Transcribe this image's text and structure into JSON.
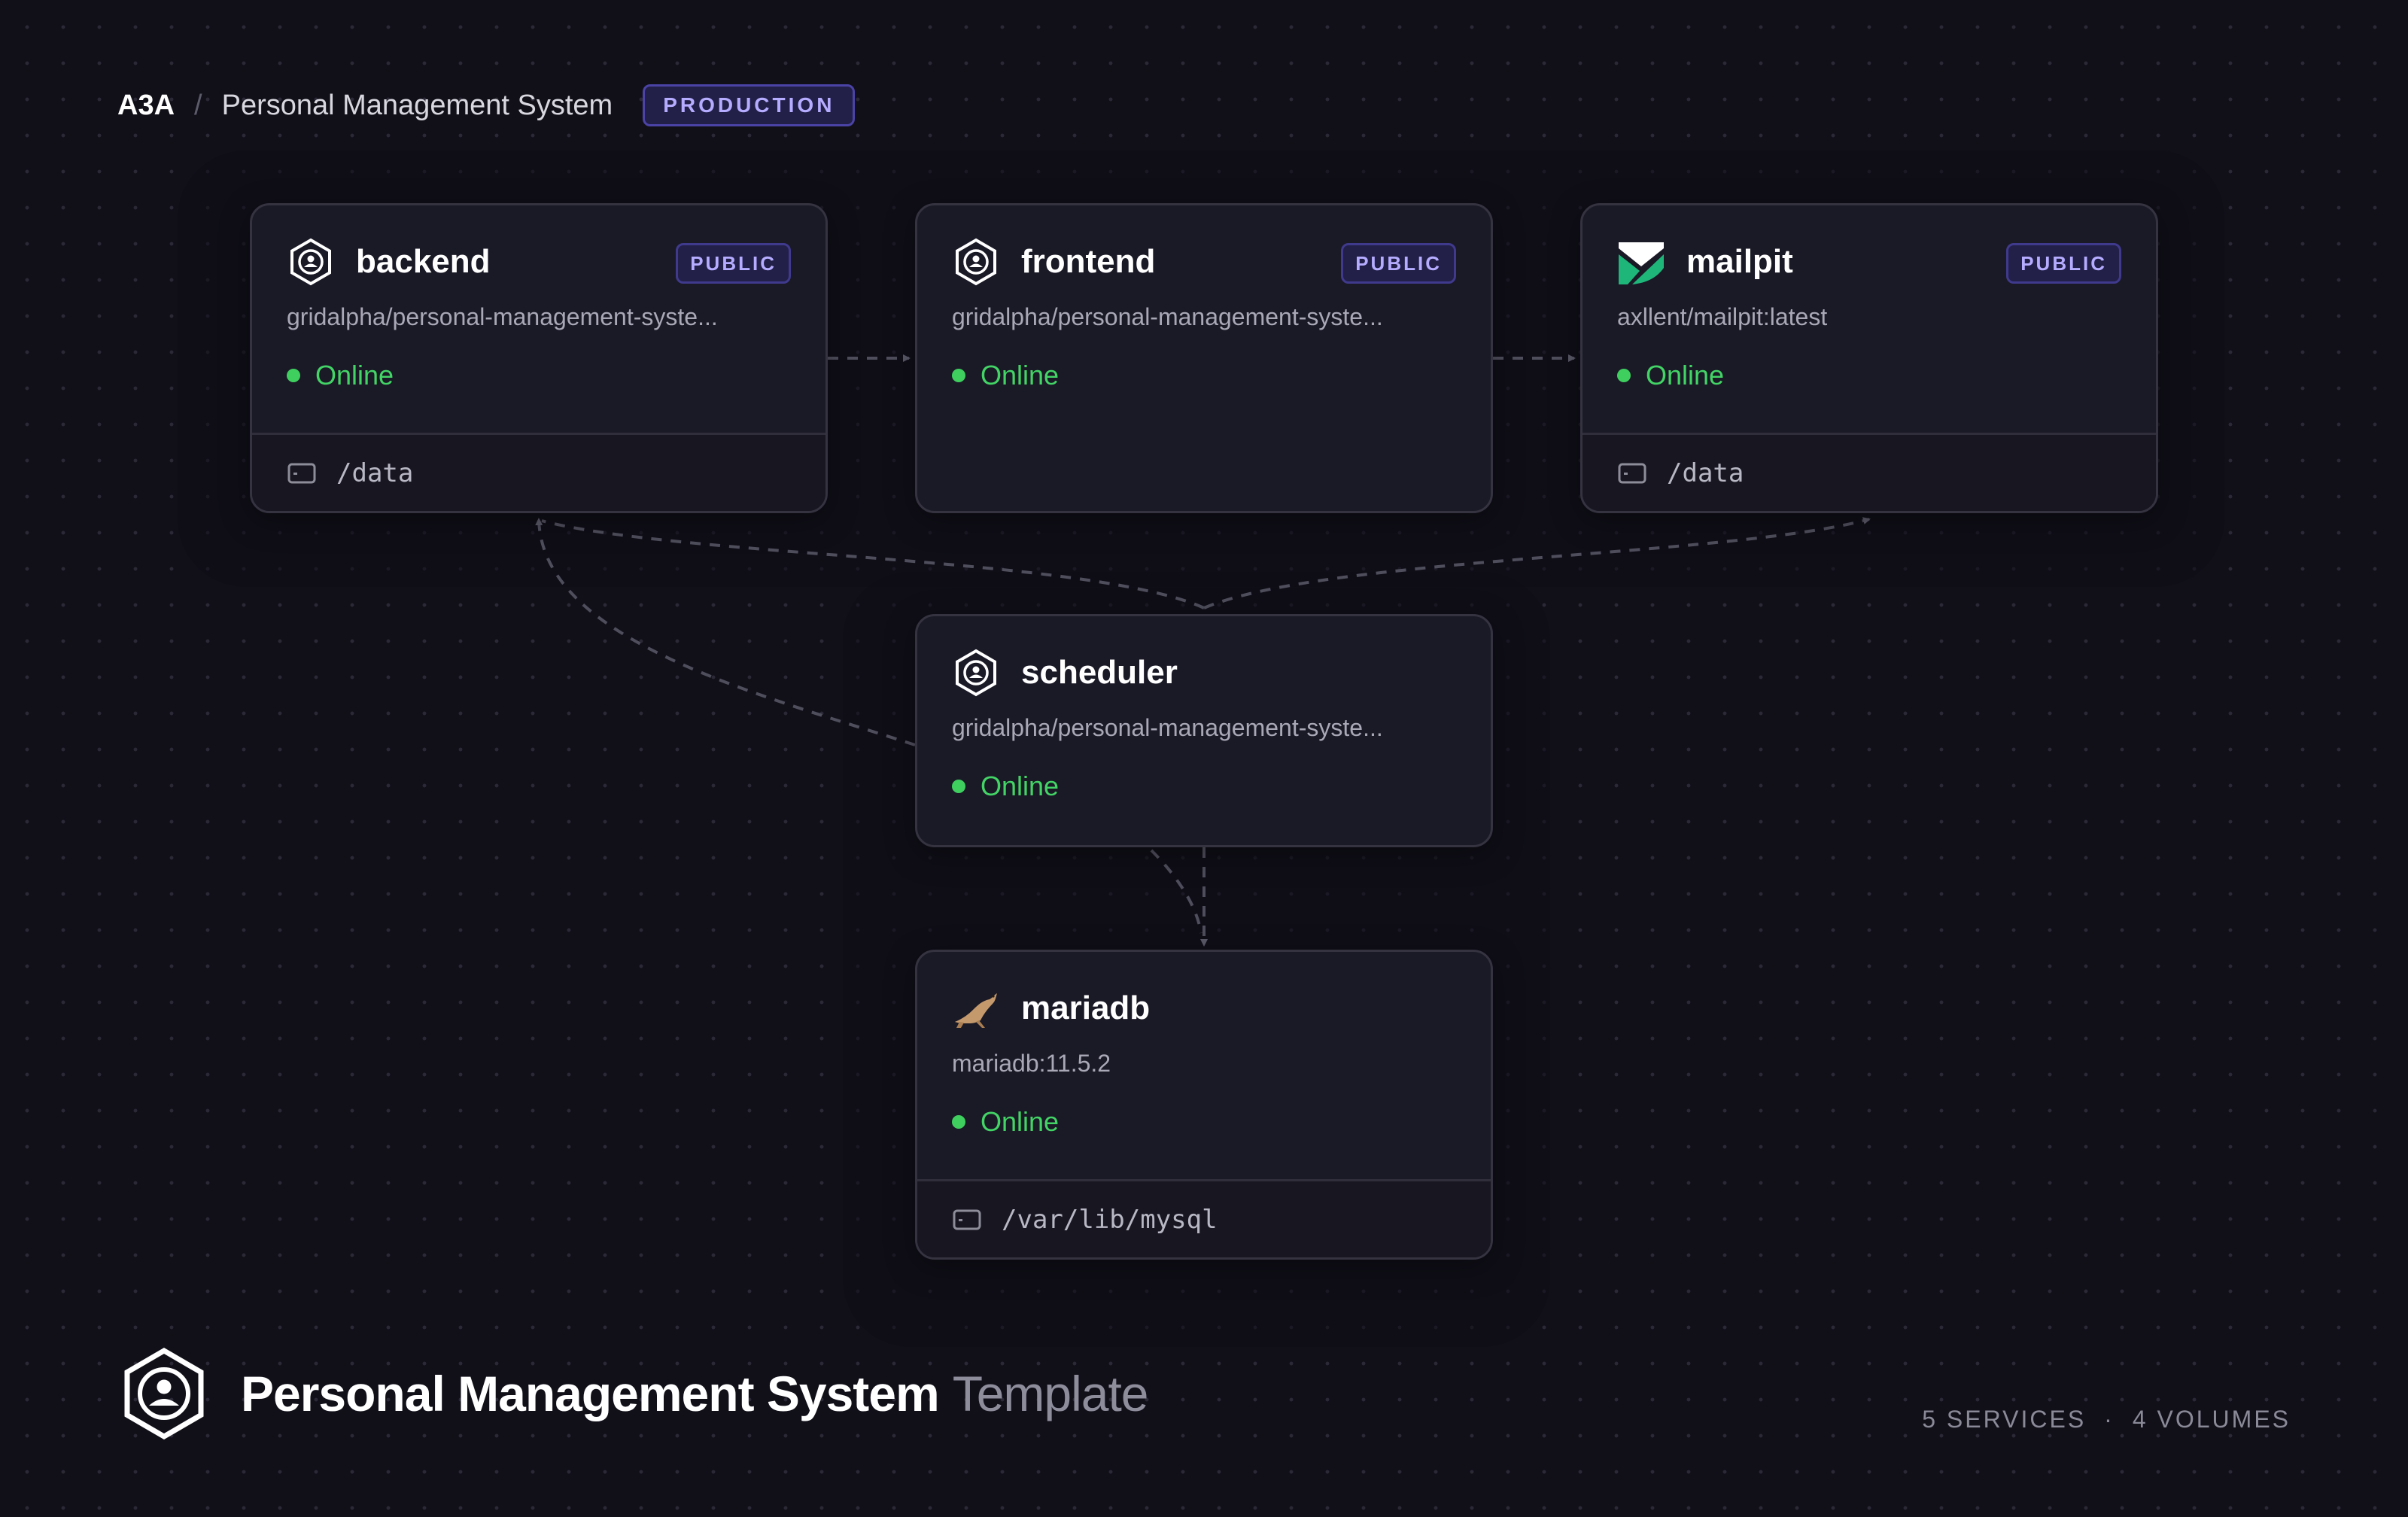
{
  "header": {
    "org": "A3A",
    "separator": "/",
    "project": "Personal Management System",
    "environment": "PRODUCTION"
  },
  "services": {
    "backend": {
      "name": "backend",
      "badge": "PUBLIC",
      "image": "gridalpha/personal-management-syste...",
      "status": "Online",
      "volume": "/data",
      "icon": "hexagon-user-icon"
    },
    "frontend": {
      "name": "frontend",
      "badge": "PUBLIC",
      "image": "gridalpha/personal-management-syste...",
      "status": "Online",
      "icon": "hexagon-user-icon"
    },
    "mailpit": {
      "name": "mailpit",
      "badge": "PUBLIC",
      "image": "axllent/mailpit:latest",
      "status": "Online",
      "volume": "/data",
      "icon": "mailpit-logo-icon"
    },
    "scheduler": {
      "name": "scheduler",
      "image": "gridalpha/personal-management-syste...",
      "status": "Online",
      "icon": "hexagon-user-icon"
    },
    "mariadb": {
      "name": "mariadb",
      "image": "mariadb:11.5.2",
      "status": "Online",
      "volume": "/var/lib/mysql",
      "icon": "mariadb-seal-icon"
    }
  },
  "footer": {
    "title": "Personal Management System",
    "suffix": "Template",
    "services_count": "5 SERVICES",
    "dot": "·",
    "volumes_count": "4 VOLUMES"
  },
  "colors": {
    "background": "#111019",
    "card": "#1a1926",
    "online": "#43d466",
    "badge_text": "#b5acff",
    "badge_bg": "#221f48",
    "mailpit_green": "#1fb67a"
  }
}
